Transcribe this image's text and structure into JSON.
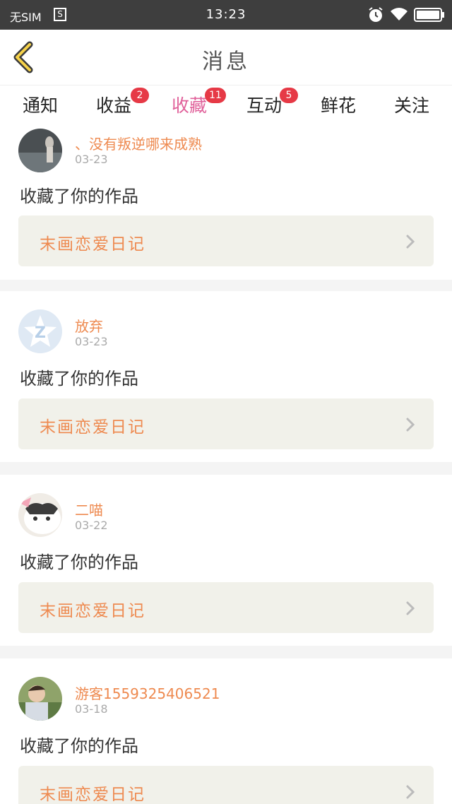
{
  "status": {
    "sim": "无SIM",
    "sim_icon": "S",
    "time": "13:23"
  },
  "header": {
    "title": "消息",
    "back_icon": "chevron-left-icon"
  },
  "tabs": [
    {
      "label": "通知",
      "badge": ""
    },
    {
      "label": "收益",
      "badge": "2"
    },
    {
      "label": "收藏",
      "badge": "11",
      "active": true
    },
    {
      "label": "互动",
      "badge": "5"
    },
    {
      "label": "鲜花",
      "badge": ""
    },
    {
      "label": "关注",
      "badge": ""
    }
  ],
  "messages": [
    {
      "user": "、没有叛逆哪来成熟",
      "date": "03-23",
      "action": "收藏了你的作品",
      "work": "末画恋爱日记",
      "avatar": "dark-photo"
    },
    {
      "user": "放弃",
      "date": "03-23",
      "action": "收藏了你的作品",
      "work": "末画恋爱日记",
      "avatar": "qzone-default"
    },
    {
      "user": "二喵",
      "date": "03-22",
      "action": "收藏了你的作品",
      "work": "末画恋爱日记",
      "avatar": "cat"
    },
    {
      "user": "游客15593254065​21",
      "date": "03-18",
      "action": "收藏了你的作品",
      "work": "末画恋爱日记",
      "avatar": "person-photo"
    }
  ],
  "colors": {
    "accent": "#e0609a",
    "username": "#ee8a50",
    "badge": "#e63946"
  }
}
